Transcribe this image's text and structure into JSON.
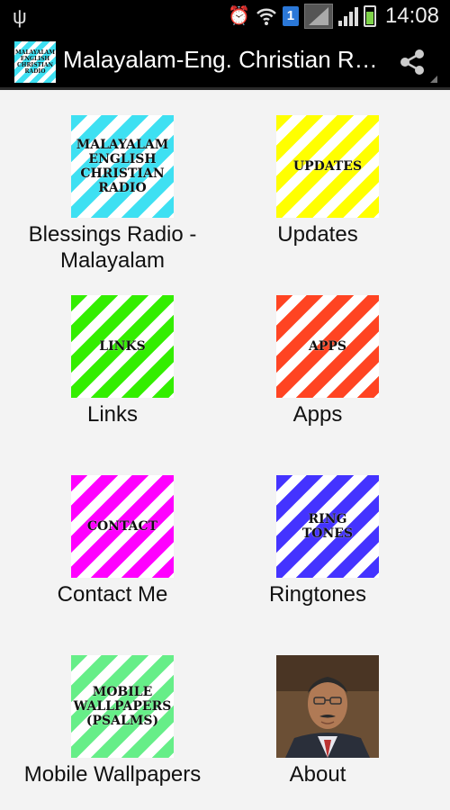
{
  "status_bar": {
    "time": "14:08",
    "notification_badge": "1",
    "icons": [
      "usb-icon",
      "alarm-icon",
      "wifi-icon",
      "signal-icon",
      "battery-icon"
    ]
  },
  "action_bar": {
    "logo_text": [
      "MALAYALAM",
      "ENGLISH",
      "CHRISTIAN",
      "RADIO"
    ],
    "title": "Malayalam-Eng. Christian Ra…",
    "share_icon": "share-icon"
  },
  "tiles": [
    {
      "label": "Blessings Radio - Malayalam",
      "thumb_lines": [
        "MALAYALAM",
        "ENGLISH",
        "CHRISTIAN",
        "RADIO"
      ],
      "color": "#3ee0f2"
    },
    {
      "label": "Updates",
      "thumb_lines": [
        "UPDATES"
      ],
      "color": "#ffff00"
    },
    {
      "label": "Links",
      "thumb_lines": [
        "LINKS"
      ],
      "color": "#33ee00"
    },
    {
      "label": "Apps",
      "thumb_lines": [
        "APPS"
      ],
      "color": "#ff4422"
    },
    {
      "label": "Contact Me",
      "thumb_lines": [
        "CONTACT"
      ],
      "color": "#ff00ff"
    },
    {
      "label": "Ringtones",
      "thumb_lines": [
        "RING",
        "TONES"
      ],
      "color": "#4433ff"
    },
    {
      "label": "Mobile Wallpapers",
      "thumb_lines": [
        "MOBILE",
        "WALLPAPERS",
        "(PSALMS)"
      ],
      "color": "#66ee88"
    },
    {
      "label": "About",
      "thumb_lines": [],
      "color": "#6b4f35"
    }
  ]
}
